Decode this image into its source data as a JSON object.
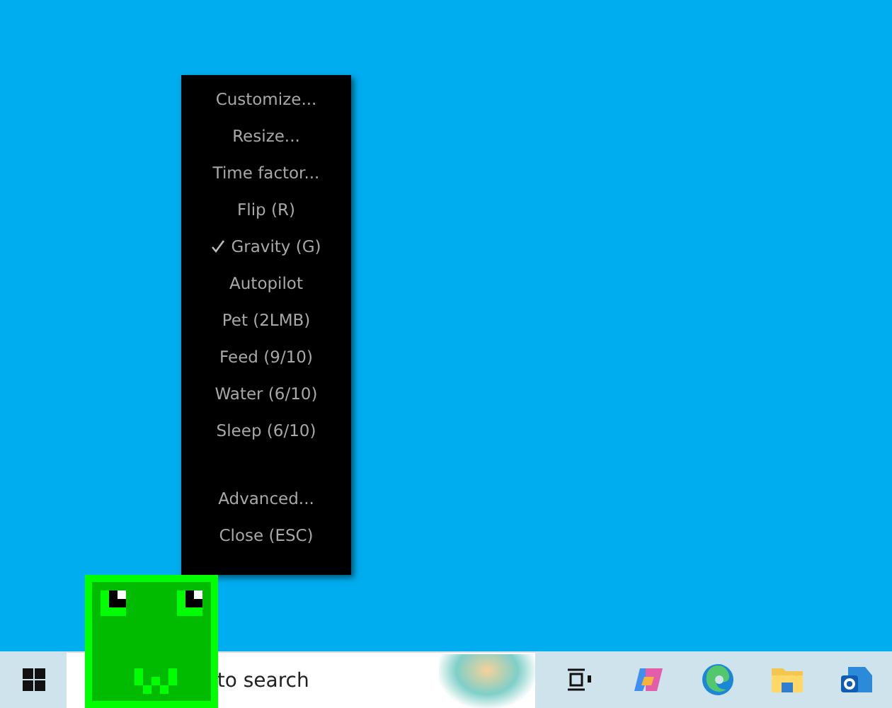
{
  "context_menu": {
    "items": [
      {
        "kind": "item",
        "label": "Customize...",
        "checked": false
      },
      {
        "kind": "item",
        "label": "Resize...",
        "checked": false
      },
      {
        "kind": "item",
        "label": "Time factor...",
        "checked": false
      },
      {
        "kind": "item",
        "label": "Flip (R)",
        "checked": false
      },
      {
        "kind": "item",
        "label": "Gravity (G)",
        "checked": true
      },
      {
        "kind": "item",
        "label": "Autopilot",
        "checked": false
      },
      {
        "kind": "item",
        "label": "Pet (2LMB)",
        "checked": false
      },
      {
        "kind": "item",
        "label": "Feed (9/10)",
        "checked": false
      },
      {
        "kind": "item",
        "label": "Water (6/10)",
        "checked": false
      },
      {
        "kind": "item",
        "label": "Sleep (6/10)",
        "checked": false
      },
      {
        "kind": "spacer"
      },
      {
        "kind": "item",
        "label": "Advanced...",
        "checked": false
      },
      {
        "kind": "item",
        "label": "Close (ESC)",
        "checked": false
      }
    ]
  },
  "taskbar": {
    "search": {
      "value": "to search"
    }
  }
}
